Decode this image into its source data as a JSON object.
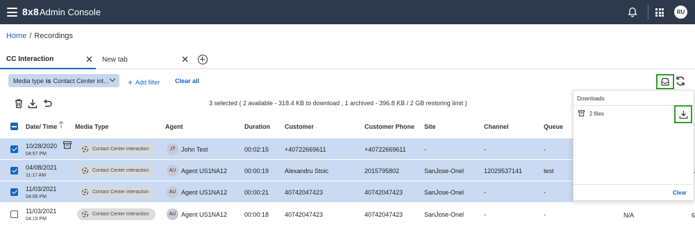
{
  "app": {
    "brand": "8x8",
    "title": "Admin Console",
    "user_initials": "RU"
  },
  "breadcrumb": {
    "home": "Home",
    "separator": "/",
    "current": "Recordings"
  },
  "tabs": [
    {
      "label": "CC Interaction",
      "active": true
    },
    {
      "label": "New tab",
      "active": false
    }
  ],
  "filter": {
    "chip_key": "Media type",
    "chip_op": "is",
    "chip_value": "Contact Center int...",
    "add_filter_label": "Add filter",
    "clear_all_label": "Clear all"
  },
  "selection_summary": "3 selected ( 2 available - 318.4 KB to download , 1 archived - 396.8 KB / 2 GB restoring limit )",
  "table": {
    "columns": [
      "Date/ Time",
      "Media Type",
      "Agent",
      "Duration",
      "Customer",
      "Customer Phone",
      "Site",
      "Channel",
      "Queue"
    ],
    "rows": [
      {
        "selected": true,
        "archived": true,
        "date": "10/28/2020",
        "time": "04:57 PM",
        "media": "Contact Center interaction",
        "agent_initials": "JT",
        "agent": "John Test",
        "duration": "00:02:15",
        "customer": "+40722669611",
        "phone": "+40722669611",
        "site": "-",
        "channel": "-",
        "queue": "-"
      },
      {
        "selected": true,
        "archived": false,
        "date": "04/08/2021",
        "time": "11:17 AM",
        "media": "Contact Center interaction",
        "agent_initials": "AU",
        "agent": "Agent US1NA12",
        "duration": "00:00:19",
        "customer": "Alexandru Stoic",
        "phone": "2015795802",
        "site": "SanJose-Onel",
        "channel": "12029537141",
        "queue": "test"
      },
      {
        "selected": true,
        "archived": false,
        "date": "11/03/2021",
        "time": "04:06 PM",
        "media": "Contact Center interaction",
        "agent_initials": "AU",
        "agent": "Agent US1NA12",
        "duration": "00:00:21",
        "customer": "40742047423",
        "phone": "40742047423",
        "site": "SanJose-Onel",
        "channel": "-",
        "queue": "-"
      },
      {
        "selected": false,
        "archived": false,
        "date": "11/03/2021",
        "time": "04:15 PM",
        "media": "Contact Center interaction",
        "agent_initials": "AU",
        "agent": "Agent US1NA12",
        "duration": "00:00:18",
        "customer": "40742047423",
        "phone": "40742047423",
        "site": "SanJose-Onel",
        "channel": "-",
        "queue": "-"
      }
    ],
    "overflow_row2_last": "6",
    "overflow_row4_na": "N/A",
    "overflow_row4_last": "6"
  },
  "downloads": {
    "title": "Downloads",
    "item_label": "2 files",
    "clear_label": "Clear"
  },
  "colors": {
    "topbar": "#2e3a4c",
    "accent": "#1565c0",
    "selected_row": "#c9daf2",
    "highlight_box": "#2e9e28"
  }
}
